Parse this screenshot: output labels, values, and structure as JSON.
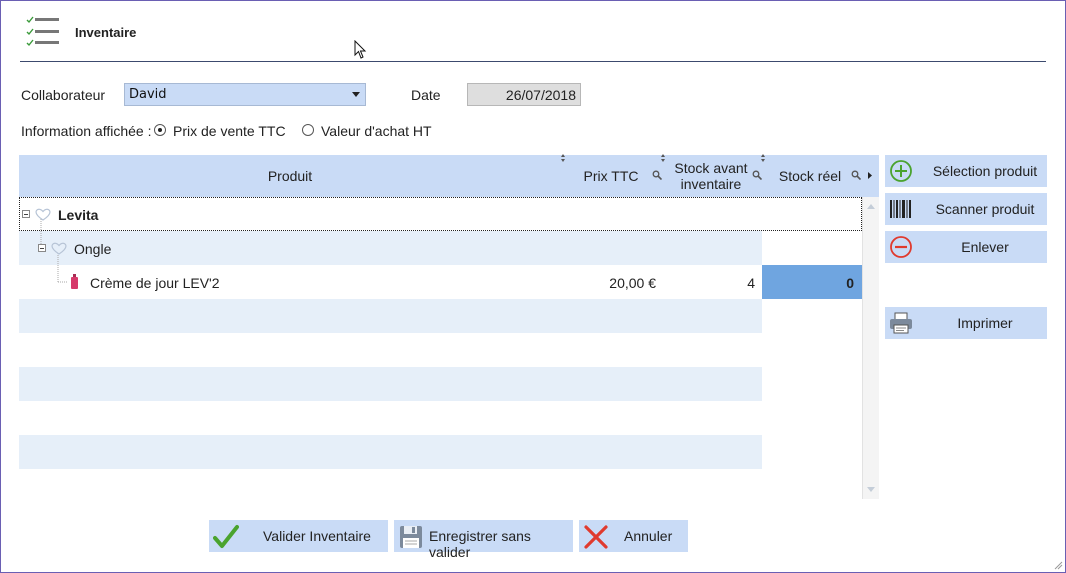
{
  "window": {
    "title": "Inventaire"
  },
  "form": {
    "collaborateur_label": "Collaborateur",
    "collaborateur_value": "David",
    "date_label": "Date",
    "date_value": "26/07/2018",
    "info_label": "Information affichée :",
    "options": [
      {
        "label": "Prix de vente TTC",
        "selected": true
      },
      {
        "label": "Valeur d'achat HT",
        "selected": false
      }
    ]
  },
  "table": {
    "columns": {
      "produit": "Produit",
      "prix": "Prix TTC",
      "stock_avant_line1": "Stock avant",
      "stock_avant_line2": "inventaire",
      "stock_reel": "Stock réel"
    },
    "tree": {
      "level1": "Levita",
      "level2": "Ongle",
      "product": {
        "name": "Crème de jour LEV'2",
        "prix": "20,00 €",
        "stock_avant": "4",
        "stock_reel": "0"
      }
    }
  },
  "actions": {
    "selection": "Sélection produit",
    "scanner": "Scanner produit",
    "enlever": "Enlever",
    "imprimer": "Imprimer"
  },
  "footer": {
    "valider": "Valider Inventaire",
    "enregistrer": "Enregistrer sans valider",
    "annuler": "Annuler"
  },
  "colors": {
    "header_blue": "#c9dbf6",
    "selected_cell": "#6fa5e0",
    "alt_row": "#e6eff9",
    "check_green": "#4aa32e",
    "cancel_red": "#e03a2e"
  }
}
